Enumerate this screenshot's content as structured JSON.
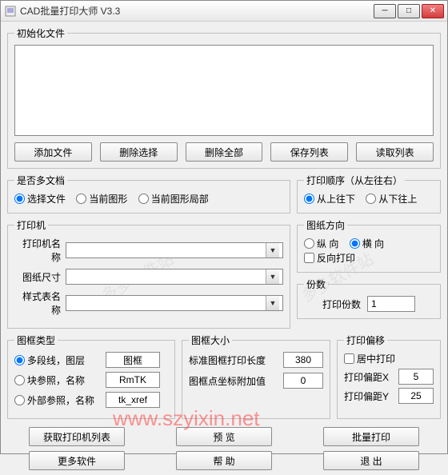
{
  "window": {
    "title": "CAD批量打印大师 V3.3"
  },
  "groups": {
    "init": "初始化文件",
    "multidoc": "是否多文档",
    "order": "打印顺序（从左往右）",
    "printer": "打印机",
    "orient": "图纸方向",
    "copies": "份数",
    "frametype": "图框类型",
    "framesize": "图框大小",
    "offset": "打印偏移"
  },
  "btns": {
    "add": "添加文件",
    "delsel": "删除选择",
    "delall": "删除全部",
    "savelist": "保存列表",
    "loadlist": "读取列表",
    "getprinters": "获取打印机列表",
    "preview": "预 览",
    "batch": "批量打印",
    "moresoft": "更多软件",
    "help": "帮 助",
    "exit": "退 出"
  },
  "radios": {
    "selfile": "选择文件",
    "curdwg": "当前图形",
    "curpart": "当前图形局部",
    "topdown": "从上往下",
    "bottomup": "从下往上",
    "portrait": "纵 向",
    "landscape": "横 向",
    "polyline": "多段线，图层",
    "blockref": "块参照，名称",
    "xref": "外部参照，名称"
  },
  "labels": {
    "printername": "打印机名称",
    "papersize": "图纸尺寸",
    "stylename": "样式表名称",
    "reverse": "反向打印",
    "copies": "打印份数",
    "stdlen": "标准图框打印长度",
    "coordadd": "图框点坐标附加值",
    "center": "居中打印",
    "offx": "打印偏距X",
    "offy": "打印偏距Y"
  },
  "values": {
    "polyline": "图框",
    "blockref": "RmTK",
    "xref": "tk_xref",
    "copies": "1",
    "stdlen": "380",
    "coordadd": "0",
    "offx": "5",
    "offy": "25"
  },
  "watermark": "www.szyixin.net"
}
